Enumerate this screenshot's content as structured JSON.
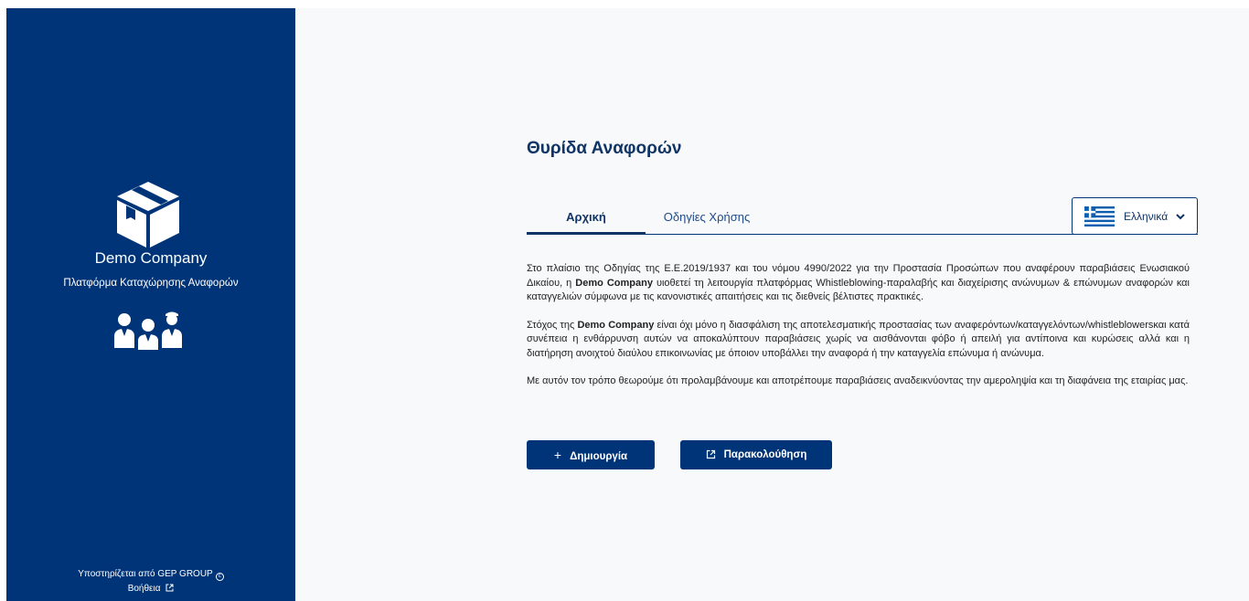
{
  "sidebar": {
    "company_name": "Demo Company",
    "subtitle": "Πλατφόρμα Καταχώρησης Αναφορών",
    "logo_icon": "box-icon",
    "people_icon": "people-icon",
    "footer_support": "Υποστηρίζεται από GEP GROUP",
    "footer_help": "Βοήθεια"
  },
  "main": {
    "title": "Θυρίδα Αναφορών",
    "tabs": [
      {
        "label": "Αρχική",
        "active": true
      },
      {
        "label": "Οδηγίες Χρήσης",
        "active": false
      }
    ],
    "language": {
      "selected": "Ελληνικά",
      "flag": "greece-flag-icon"
    },
    "paragraphs": [
      {
        "before": "Στο πλαίσιο της Οδηγίας της Ε.Ε.2019/1937 και του νόμου 4990/2022 για την Προστασία Προσώπων που αναφέρουν παραβιάσεις Ενωσιακού Δικαίου, η ",
        "bold": "Demo Company",
        "after": " υιοθετεί τη λειτουργία πλατφόρμας Whistleblowing-παραλαβής και διαχείρισης ανώνυμων & επώνυμων αναφορών και καταγγελιών σύμφωνα με τις κανονιστικές απαιτήσεις και τις διεθνείς βέλτιστες πρακτικές."
      },
      {
        "before": "Στόχος της ",
        "bold": "Demo Company",
        "after": " είναι όχι μόνο η διασφάλιση της αποτελεσματικής προστασίας των αναφερόντων/καταγγελόντων/whistleblowersκαι κατά συνέπεια η ενθάρρυνση αυτών να αποκαλύπτουν παραβιάσεις χωρίς να αισθάνονται φόβο ή απειλή για αντίποινα και κυρώσεις αλλά και η διατήρηση ανοιχτού διαύλου επικοινωνίας με όποιον υποβάλλει την αναφορά ή την καταγγελία επώνυμα ή ανώνυμα."
      },
      {
        "before": "Με αυτόν τον τρόπο θεωρούμε ότι προλαμβάνουμε και αποτρέπουμε παραβιάσεις αναδεικνύοντας την αμεροληψία και τη διαφάνεια της εταιρίας μας.",
        "bold": "",
        "after": ""
      }
    ],
    "buttons": {
      "create": "Δημιουργία",
      "track": "Παρακολούθηση"
    }
  },
  "colors": {
    "sidebar_bg": "#003478",
    "accent": "#0f3466",
    "page_bg": "#f8f9fa"
  }
}
